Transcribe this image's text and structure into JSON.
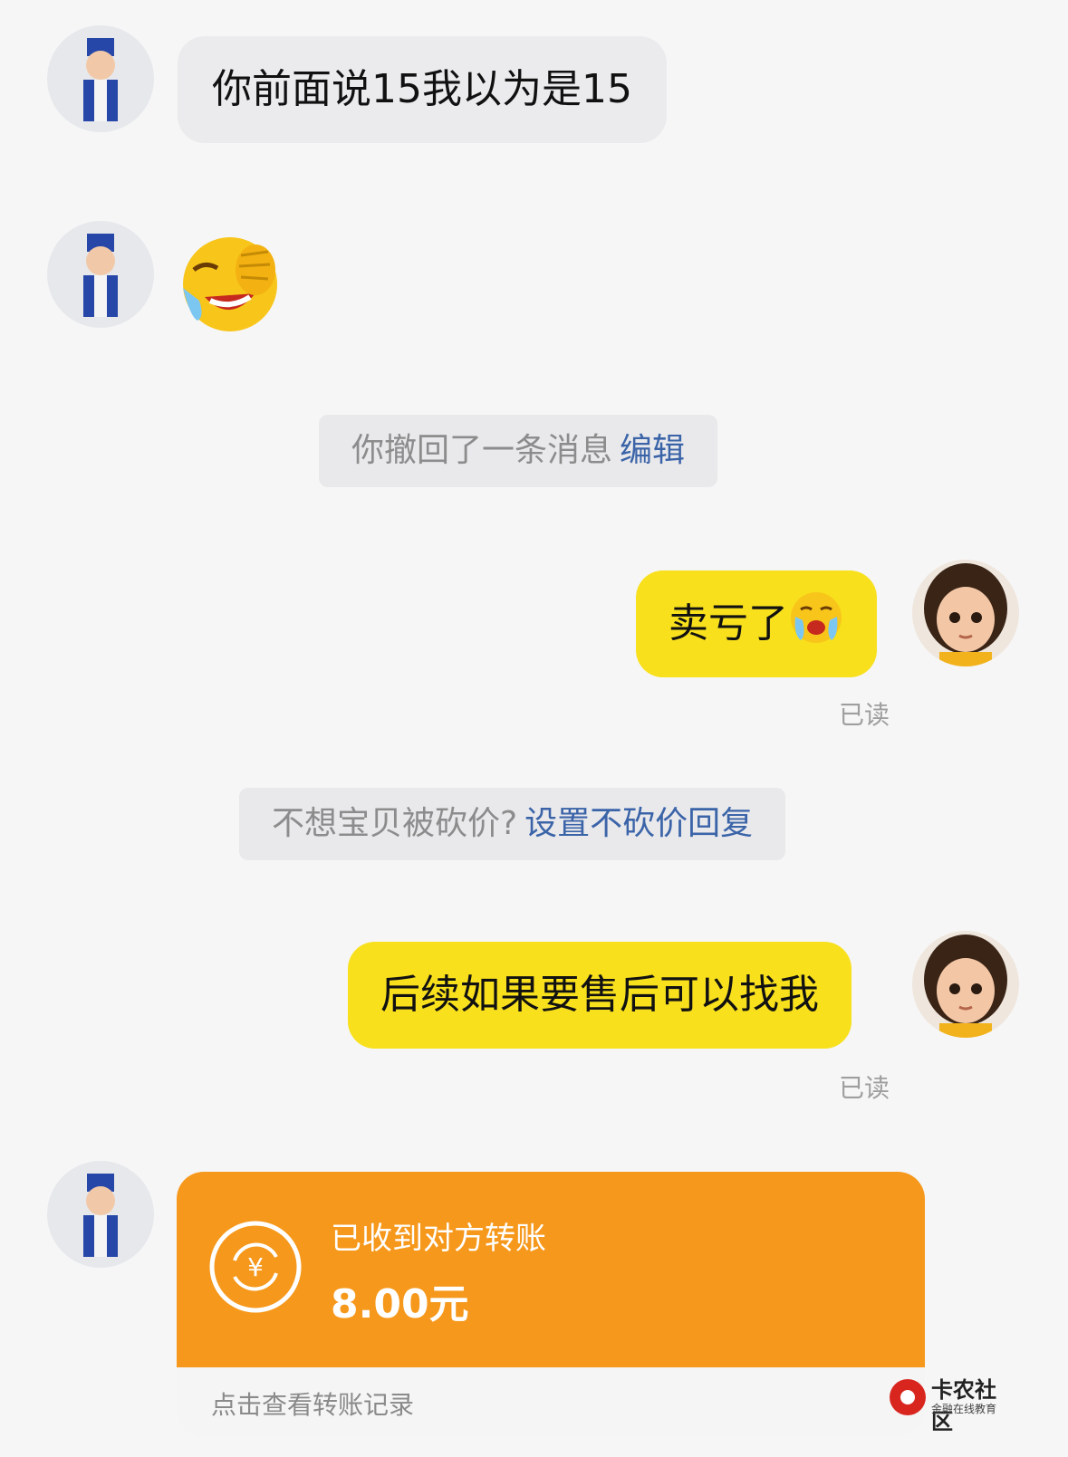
{
  "messages": {
    "m1_text": "你前面说15我以为是15",
    "recall_tip": "你撤回了一条消息",
    "recall_edit": "编辑",
    "m_out1_text": "卖亏了",
    "read1": "已读",
    "bargain_tip": "不想宝贝被砍价?",
    "bargain_link": "设置不砍价回复",
    "m_out2_text": "后续如果要售后可以找我",
    "read2": "已读"
  },
  "transfer": {
    "title": "已收到对方转账",
    "amount": "8.00元",
    "link": "点击查看转账记录",
    "icon": "yuan-exchange-icon"
  },
  "watermark": {
    "name": "卡农社区",
    "tagline": "金融在线教育"
  },
  "colors": {
    "incoming_bubble": "#ebebee",
    "outgoing_bubble": "#f8e01d",
    "transfer_orange": "#f6981b",
    "link_blue": "#3b64a8"
  }
}
